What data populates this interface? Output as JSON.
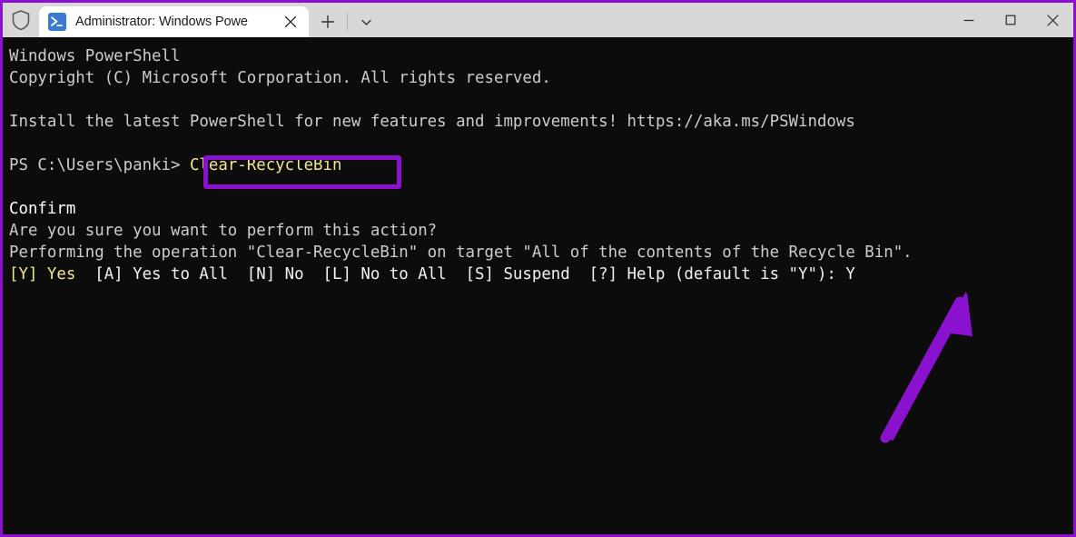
{
  "window": {
    "title": "Administrator: Windows PowerShell",
    "accent_color": "#8A12CE",
    "titlebar_bg": "#d8d8d8",
    "terminal_bg": "#0c0c0c"
  },
  "titlebar": {
    "shield_icon": "shield-icon",
    "tab": {
      "icon": "powershell-icon",
      "label": "Administrator: Windows Powe",
      "close_label": "✕"
    },
    "new_tab_label": "+",
    "dropdown_label": "⌄",
    "minimize_label": "—",
    "maximize_label": "☐",
    "close_label": "✕"
  },
  "terminal": {
    "lines": [
      {
        "id": "banner-title",
        "segments": [
          {
            "text": "Windows PowerShell",
            "color": "gray"
          }
        ]
      },
      {
        "id": "banner-copyright",
        "segments": [
          {
            "text": "Copyright (C) Microsoft Corporation. All rights reserved.",
            "color": "gray"
          }
        ]
      },
      {
        "id": "blank-1",
        "segments": [
          {
            "text": "",
            "color": "gray"
          }
        ]
      },
      {
        "id": "banner-install",
        "segments": [
          {
            "text": "Install the latest PowerShell for new features and improvements! https://aka.ms/PSWindows",
            "color": "gray"
          }
        ]
      },
      {
        "id": "blank-2",
        "segments": [
          {
            "text": "",
            "color": "gray"
          }
        ]
      },
      {
        "id": "prompt-line",
        "segments": [
          {
            "text": "PS C:\\Users\\panki> ",
            "color": "gray"
          },
          {
            "text": "Clear-RecycleBin",
            "color": "yellow"
          }
        ]
      },
      {
        "id": "blank-3",
        "segments": [
          {
            "text": "",
            "color": "gray"
          }
        ]
      },
      {
        "id": "confirm-heading",
        "segments": [
          {
            "text": "Confirm",
            "color": "bright"
          }
        ]
      },
      {
        "id": "confirm-question",
        "segments": [
          {
            "text": "Are you sure you want to perform this action?",
            "color": "gray"
          }
        ]
      },
      {
        "id": "confirm-operation",
        "segments": [
          {
            "text": "Performing the operation \"Clear-RecycleBin\" on target \"All of the contents of the Recycle Bin\".",
            "color": "gray"
          }
        ]
      },
      {
        "id": "confirm-choices",
        "segments": [
          {
            "text": "[Y] Yes",
            "color": "yellow"
          },
          {
            "text": "  [A] Yes to All  [N] No  [L] No to All  [S] Suspend  [?] Help (default is \"Y\"): Y",
            "color": "white"
          }
        ]
      }
    ],
    "prompt_path": "PS C:\\Users\\panki>",
    "typed_command": "Clear-RecycleBin",
    "typed_answer": "Y"
  },
  "annotations": {
    "command_box": {
      "name": "clear-recyclebin-highlight",
      "color": "#8A12CE"
    },
    "arrow": {
      "name": "answer-arrow",
      "color": "#8A12CE",
      "points_to": "Y"
    }
  }
}
